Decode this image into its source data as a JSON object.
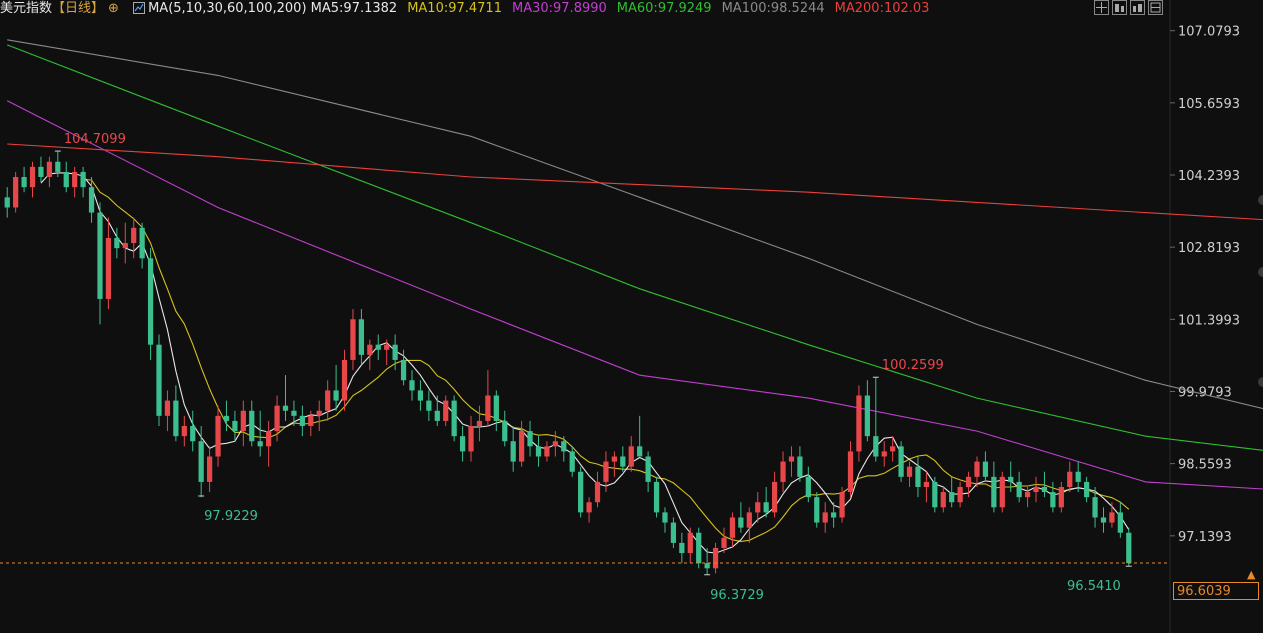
{
  "legend": {
    "title": "美元指数",
    "period": "【日线】",
    "ma_config": "MA(5,10,30,60,100,200)",
    "items": [
      {
        "text": "MA5:97.1382",
        "color": "#e8e8e8"
      },
      {
        "text": "MA10:97.4711",
        "color": "#d6c11e"
      },
      {
        "text": "MA30:97.8990",
        "color": "#c23fd0"
      },
      {
        "text": "MA60:97.9249",
        "color": "#2fbf2f"
      },
      {
        "text": "MA100:98.5244",
        "color": "#8a8a8a"
      },
      {
        "text": "MA200:102.03",
        "color": "#e8413c"
      }
    ]
  },
  "current_price": "96.6039",
  "colors": {
    "up": "#e8474a",
    "down": "#3bbf8f",
    "price_line": "#e8892a",
    "background": "#0f0f10"
  },
  "chart_data": {
    "type": "candlestick",
    "ylim": [
      96.25,
      107.25
    ],
    "yticks": [
      "107.0793",
      "105.6593",
      "104.2393",
      "102.8193",
      "101.3993",
      "99.9793",
      "98.5593",
      "97.1393"
    ],
    "annotations": [
      {
        "label": "104.7099",
        "type": "high"
      },
      {
        "label": "100.2599",
        "type": "high"
      },
      {
        "label": "97.9229",
        "type": "low"
      },
      {
        "label": "96.3729",
        "type": "low"
      },
      {
        "label": "96.5410",
        "type": "low"
      }
    ],
    "candles": [
      [
        103.8,
        104.0,
        103.4,
        103.6
      ],
      [
        103.6,
        104.3,
        103.5,
        104.2
      ],
      [
        104.2,
        104.4,
        103.9,
        104.0
      ],
      [
        104.0,
        104.5,
        103.8,
        104.4
      ],
      [
        104.4,
        104.6,
        104.1,
        104.2
      ],
      [
        104.2,
        104.6,
        104.0,
        104.5
      ],
      [
        104.5,
        104.7,
        104.2,
        104.3
      ],
      [
        104.3,
        104.5,
        103.9,
        104.0
      ],
      [
        104.0,
        104.4,
        103.8,
        104.3
      ],
      [
        104.3,
        104.4,
        103.8,
        104.0
      ],
      [
        104.0,
        104.2,
        103.3,
        103.5
      ],
      [
        103.5,
        103.7,
        101.3,
        101.8
      ],
      [
        101.8,
        103.4,
        101.6,
        103.0
      ],
      [
        103.0,
        103.2,
        102.6,
        102.8
      ],
      [
        102.8,
        103.3,
        102.5,
        102.9
      ],
      [
        102.9,
        103.4,
        102.6,
        103.2
      ],
      [
        103.2,
        103.3,
        102.4,
        102.6
      ],
      [
        102.6,
        102.8,
        100.6,
        100.9
      ],
      [
        100.9,
        101.1,
        99.3,
        99.5
      ],
      [
        99.5,
        100.0,
        99.2,
        99.8
      ],
      [
        99.8,
        100.1,
        99.0,
        99.1
      ],
      [
        99.1,
        99.5,
        98.9,
        99.3
      ],
      [
        99.3,
        99.6,
        98.8,
        99.0
      ],
      [
        99.0,
        99.3,
        97.9,
        98.2
      ],
      [
        98.2,
        98.9,
        98.0,
        98.7
      ],
      [
        98.7,
        99.7,
        98.5,
        99.5
      ],
      [
        99.5,
        99.8,
        99.2,
        99.4
      ],
      [
        99.4,
        99.6,
        99.0,
        99.2
      ],
      [
        99.2,
        99.8,
        98.9,
        99.6
      ],
      [
        99.6,
        99.8,
        98.9,
        99.0
      ],
      [
        99.0,
        99.6,
        98.7,
        98.9
      ],
      [
        98.9,
        99.4,
        98.5,
        99.2
      ],
      [
        99.2,
        99.9,
        99.0,
        99.7
      ],
      [
        99.7,
        100.3,
        99.4,
        99.6
      ],
      [
        99.6,
        99.8,
        99.3,
        99.5
      ],
      [
        99.5,
        99.7,
        99.1,
        99.3
      ],
      [
        99.3,
        99.6,
        99.1,
        99.5
      ],
      [
        99.5,
        99.8,
        99.2,
        99.6
      ],
      [
        99.6,
        100.2,
        99.4,
        100.0
      ],
      [
        100.0,
        100.5,
        99.6,
        99.8
      ],
      [
        99.8,
        100.8,
        99.6,
        100.6
      ],
      [
        100.6,
        101.6,
        100.4,
        101.4
      ],
      [
        101.4,
        101.6,
        100.5,
        100.7
      ],
      [
        100.7,
        101.0,
        100.4,
        100.9
      ],
      [
        100.9,
        101.1,
        100.6,
        100.8
      ],
      [
        100.8,
        101.0,
        100.5,
        100.9
      ],
      [
        100.9,
        101.1,
        100.4,
        100.6
      ],
      [
        100.6,
        100.8,
        100.1,
        100.2
      ],
      [
        100.2,
        100.4,
        99.8,
        100.0
      ],
      [
        100.0,
        100.2,
        99.6,
        99.8
      ],
      [
        99.8,
        100.0,
        99.4,
        99.6
      ],
      [
        99.6,
        99.9,
        99.3,
        99.4
      ],
      [
        99.4,
        99.9,
        99.3,
        99.8
      ],
      [
        99.8,
        99.9,
        99.0,
        99.1
      ],
      [
        99.1,
        99.3,
        98.6,
        98.8
      ],
      [
        98.8,
        99.5,
        98.6,
        99.3
      ],
      [
        99.3,
        99.7,
        99.0,
        99.4
      ],
      [
        99.4,
        100.4,
        99.3,
        99.9
      ],
      [
        99.9,
        100.0,
        99.2,
        99.4
      ],
      [
        99.4,
        99.6,
        98.9,
        99.0
      ],
      [
        99.0,
        99.3,
        98.4,
        98.6
      ],
      [
        98.6,
        99.4,
        98.5,
        99.2
      ],
      [
        99.2,
        99.4,
        98.7,
        98.9
      ],
      [
        98.9,
        99.1,
        98.5,
        98.7
      ],
      [
        98.7,
        99.0,
        98.6,
        98.9
      ],
      [
        98.9,
        99.2,
        98.7,
        99.0
      ],
      [
        99.0,
        99.1,
        98.6,
        98.8
      ],
      [
        98.8,
        98.9,
        98.3,
        98.4
      ],
      [
        98.4,
        98.5,
        97.5,
        97.6
      ],
      [
        97.6,
        97.9,
        97.4,
        97.8
      ],
      [
        97.8,
        98.4,
        97.7,
        98.2
      ],
      [
        98.2,
        98.8,
        98.0,
        98.6
      ],
      [
        98.6,
        98.8,
        98.3,
        98.7
      ],
      [
        98.7,
        98.9,
        98.4,
        98.5
      ],
      [
        98.5,
        99.1,
        98.4,
        98.9
      ],
      [
        98.9,
        99.5,
        98.8,
        98.7
      ],
      [
        98.7,
        98.8,
        98.0,
        98.2
      ],
      [
        98.2,
        98.3,
        97.5,
        97.6
      ],
      [
        97.6,
        97.7,
        97.2,
        97.4
      ],
      [
        97.4,
        97.5,
        96.9,
        97.0
      ],
      [
        97.0,
        97.2,
        96.6,
        96.8
      ],
      [
        96.8,
        97.3,
        96.6,
        97.2
      ],
      [
        97.2,
        97.3,
        96.5,
        96.6
      ],
      [
        96.6,
        96.9,
        96.37,
        96.5
      ],
      [
        96.5,
        97.0,
        96.4,
        96.9
      ],
      [
        96.9,
        97.3,
        96.8,
        97.1
      ],
      [
        97.1,
        97.6,
        96.9,
        97.5
      ],
      [
        97.5,
        97.8,
        97.2,
        97.3
      ],
      [
        97.3,
        97.7,
        97.0,
        97.6
      ],
      [
        97.6,
        98.0,
        97.4,
        97.8
      ],
      [
        97.8,
        98.1,
        97.5,
        97.6
      ],
      [
        97.6,
        98.4,
        97.5,
        98.2
      ],
      [
        98.2,
        98.8,
        98.0,
        98.6
      ],
      [
        98.6,
        98.9,
        98.3,
        98.7
      ],
      [
        98.7,
        98.9,
        98.2,
        98.3
      ],
      [
        98.3,
        98.5,
        97.8,
        97.9
      ],
      [
        97.9,
        98.0,
        97.3,
        97.4
      ],
      [
        97.4,
        97.8,
        97.2,
        97.6
      ],
      [
        97.6,
        97.8,
        97.3,
        97.5
      ],
      [
        97.5,
        98.1,
        97.4,
        98.0
      ],
      [
        98.0,
        99.0,
        97.9,
        98.8
      ],
      [
        98.8,
        100.1,
        98.6,
        99.9
      ],
      [
        99.9,
        100.2,
        99.0,
        99.1
      ],
      [
        99.1,
        100.26,
        98.6,
        98.7
      ],
      [
        98.7,
        99.0,
        98.5,
        98.8
      ],
      [
        98.8,
        99.1,
        98.6,
        98.9
      ],
      [
        98.9,
        99.0,
        98.2,
        98.3
      ],
      [
        98.3,
        98.6,
        98.1,
        98.5
      ],
      [
        98.5,
        98.7,
        97.9,
        98.1
      ],
      [
        98.1,
        98.4,
        97.8,
        98.2
      ],
      [
        98.2,
        98.3,
        97.6,
        97.7
      ],
      [
        97.7,
        98.1,
        97.6,
        98.0
      ],
      [
        98.0,
        98.3,
        97.7,
        97.8
      ],
      [
        97.8,
        98.2,
        97.7,
        98.1
      ],
      [
        98.1,
        98.4,
        97.9,
        98.3
      ],
      [
        98.3,
        98.7,
        98.1,
        98.6
      ],
      [
        98.6,
        98.8,
        98.2,
        98.3
      ],
      [
        98.3,
        98.6,
        97.6,
        97.7
      ],
      [
        97.7,
        98.4,
        97.6,
        98.3
      ],
      [
        98.3,
        98.6,
        98.0,
        98.2
      ],
      [
        98.2,
        98.4,
        97.8,
        97.9
      ],
      [
        97.9,
        98.1,
        97.7,
        98.0
      ],
      [
        98.0,
        98.3,
        97.8,
        98.1
      ],
      [
        98.1,
        98.4,
        97.9,
        98.0
      ],
      [
        98.0,
        98.2,
        97.6,
        97.7
      ],
      [
        97.7,
        98.2,
        97.6,
        98.1
      ],
      [
        98.1,
        98.6,
        98.0,
        98.4
      ],
      [
        98.4,
        98.6,
        98.0,
        98.2
      ],
      [
        98.2,
        98.3,
        97.8,
        97.9
      ],
      [
        97.9,
        98.1,
        97.3,
        97.5
      ],
      [
        97.5,
        97.7,
        97.2,
        97.4
      ],
      [
        97.4,
        97.8,
        97.3,
        97.6
      ],
      [
        97.6,
        97.8,
        97.1,
        97.2
      ],
      [
        97.2,
        97.3,
        96.54,
        96.6
      ]
    ],
    "moving_averages": {
      "MA30": [
        [
          0,
          105.7
        ],
        [
          25,
          103.6
        ],
        [
          55,
          101.6
        ],
        [
          75,
          100.3
        ],
        [
          95,
          99.85
        ],
        [
          115,
          99.2
        ],
        [
          135,
          98.2
        ],
        [
          155,
          98.0
        ],
        [
          170,
          98.15
        ],
        [
          188,
          97.95
        ],
        [
          205,
          98.05
        ],
        [
          219,
          97.9
        ]
      ],
      "MA60": [
        [
          0,
          106.8
        ],
        [
          25,
          105.2
        ],
        [
          55,
          103.3
        ],
        [
          75,
          102.0
        ],
        [
          95,
          100.9
        ],
        [
          115,
          99.85
        ],
        [
          135,
          99.1
        ],
        [
          155,
          98.7
        ],
        [
          170,
          98.6
        ],
        [
          188,
          98.3
        ],
        [
          205,
          98.15
        ],
        [
          219,
          97.92
        ]
      ],
      "MA100": [
        [
          0,
          106.9
        ],
        [
          25,
          106.2
        ],
        [
          55,
          105.0
        ],
        [
          75,
          103.8
        ],
        [
          95,
          102.6
        ],
        [
          115,
          101.3
        ],
        [
          135,
          100.2
        ],
        [
          155,
          99.4
        ],
        [
          170,
          98.9
        ],
        [
          188,
          98.75
        ],
        [
          205,
          98.62
        ],
        [
          219,
          98.52
        ]
      ],
      "MA200": [
        [
          0,
          104.85
        ],
        [
          25,
          104.6
        ],
        [
          55,
          104.2
        ],
        [
          75,
          104.05
        ],
        [
          95,
          103.9
        ],
        [
          115,
          103.7
        ],
        [
          135,
          103.5
        ],
        [
          155,
          103.3
        ],
        [
          170,
          103.0
        ],
        [
          188,
          102.5
        ],
        [
          205,
          102.2
        ],
        [
          219,
          102.03
        ]
      ]
    }
  }
}
